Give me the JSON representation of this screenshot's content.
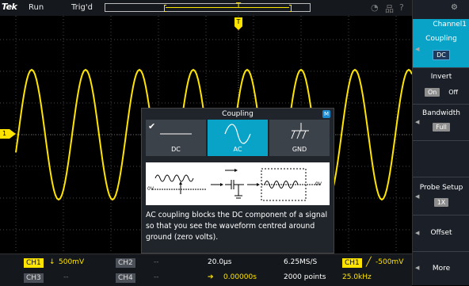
{
  "topbar": {
    "brand": "Tek",
    "run_state": "Run",
    "trigger_state": "Trig'd",
    "trigger_position_label": "T",
    "status_icons": [
      "wifi-icon",
      "network-icon",
      "help-icon"
    ]
  },
  "screen": {
    "channel_marker": "1",
    "trace_color": "#ffe400",
    "accent": "#0aa3c8"
  },
  "right_panel": {
    "title": "Channel1",
    "coupling": {
      "label": "Coupling",
      "value": "DC"
    },
    "invert": {
      "label": "Invert",
      "on": "On",
      "off": "Off"
    },
    "bandwidth": {
      "label": "Bandwidth",
      "value": "Full"
    },
    "probe": {
      "label": "Probe Setup",
      "value": "1X"
    },
    "offset": {
      "label": "Offset"
    },
    "more": {
      "label": "More"
    }
  },
  "dialog": {
    "title": "Coupling",
    "badge": "M",
    "options": [
      {
        "label": "DC"
      },
      {
        "label": "AC"
      },
      {
        "label": "GND"
      }
    ],
    "diagram": {
      "in_label": "0V",
      "out_label": "0V"
    },
    "description": "AC coupling blocks the DC component of a signal so that you see the waveform centred around ground (zero volts)."
  },
  "bottom": {
    "ch1": {
      "tag": "CH1",
      "scale": "500mV"
    },
    "ch2": {
      "tag": "CH2",
      "scale": "--"
    },
    "ch3": {
      "tag": "CH3",
      "scale": "--"
    },
    "ch4": {
      "tag": "CH4",
      "scale": "--"
    },
    "timebase": "20.0µs",
    "position": "0.00000s",
    "sample_rate": "6.25MS/S",
    "record_length": "2000 points",
    "trigger": {
      "source": "CH1",
      "level": "-500mV",
      "frequency": "25.0kHz"
    }
  }
}
